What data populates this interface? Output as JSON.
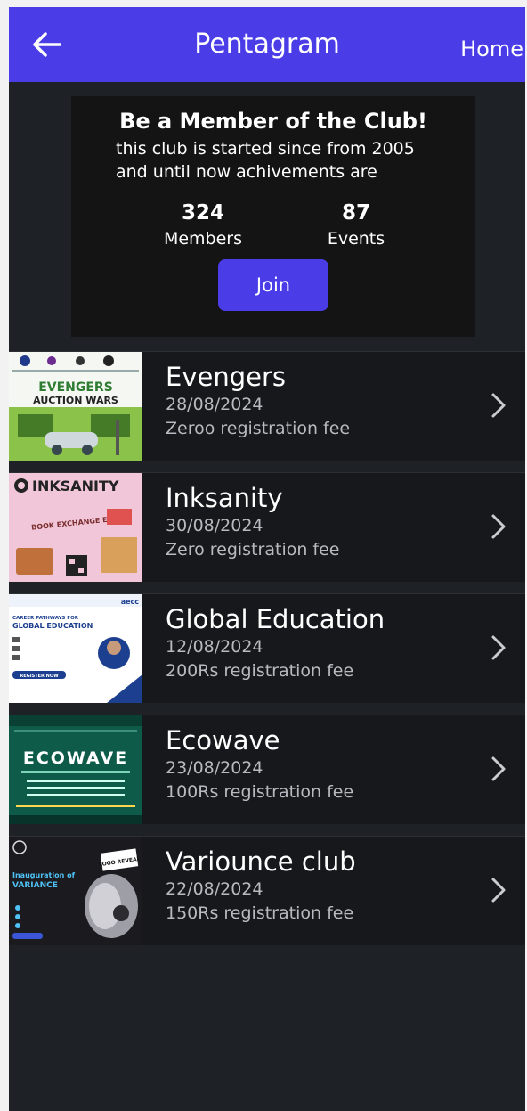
{
  "appbar": {
    "title": "Pentagram",
    "home_label": "Home",
    "back_icon": "arrow-left-icon"
  },
  "member_card": {
    "title": "Be a Member of the Club!",
    "description_line1": "this club is started since from 2005",
    "description_line2": "and until now achivements are",
    "members_count": "324",
    "members_label": "Members",
    "events_count": "87",
    "events_label": "Events",
    "join_label": "Join"
  },
  "events": [
    {
      "name": "Evengers",
      "date": "28/08/2024",
      "fee": "Zeroo registration fee",
      "poster": {
        "title": "EVENGERS",
        "subtitle": "AUCTION WARS"
      }
    },
    {
      "name": "Inksanity",
      "date": "30/08/2024",
      "fee": "Zero registration fee",
      "poster": {
        "title": "INKSANITY",
        "subtitle": "BOOK EXCHANGE EVENT"
      }
    },
    {
      "name": "Global Education",
      "date": "12/08/2024",
      "fee": "200Rs registration fee",
      "poster": {
        "title": "GLOBAL EDUCATION",
        "subtitle": "CAREER PATHWAYS FOR",
        "button": "REGISTER NOW"
      }
    },
    {
      "name": "Ecowave",
      "date": "23/08/2024",
      "fee": "100Rs registration fee",
      "poster": {
        "title": "ECOWAVE"
      }
    },
    {
      "name": "Variounce club",
      "date": "22/08/2024",
      "fee": "150Rs registration fee",
      "poster": {
        "title": "VARIANCE",
        "subtitle": "Inauguration of",
        "badge": "LOGO REVEAL"
      }
    }
  ],
  "colors": {
    "accent": "#4a3de8",
    "background": "#1e2125",
    "card": "#141414",
    "row": "#16181b",
    "muted_text": "#b7bac0"
  }
}
